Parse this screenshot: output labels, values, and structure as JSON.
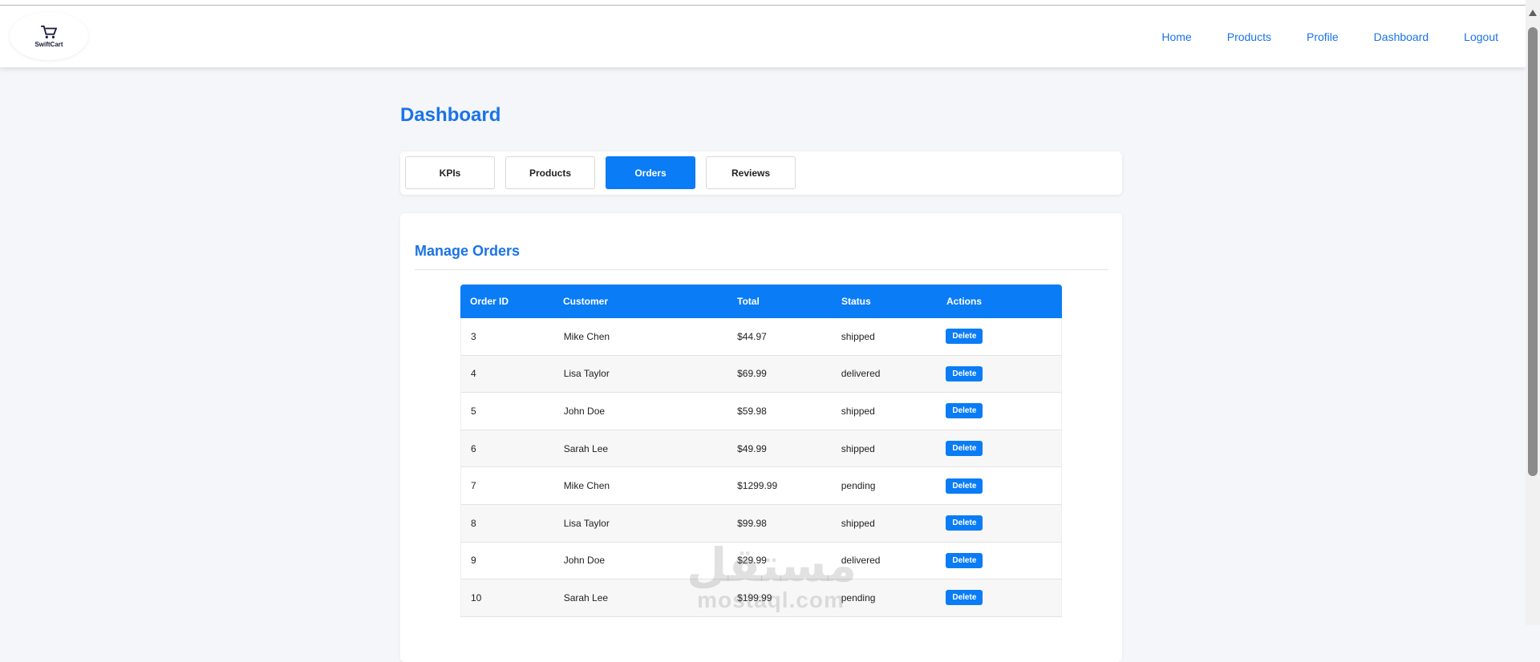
{
  "brand": {
    "name": "SwiftCart"
  },
  "nav": {
    "links": [
      "Home",
      "Products",
      "Profile",
      "Dashboard",
      "Logout"
    ]
  },
  "page": {
    "title": "Dashboard"
  },
  "tabs": [
    {
      "label": "KPIs",
      "active": false
    },
    {
      "label": "Products",
      "active": false
    },
    {
      "label": "Orders",
      "active": true
    },
    {
      "label": "Reviews",
      "active": false
    }
  ],
  "orders": {
    "title": "Manage Orders",
    "columns": [
      "Order ID",
      "Customer",
      "Total",
      "Status",
      "Actions"
    ],
    "delete_label": "Delete",
    "rows": [
      {
        "id": "3",
        "customer": "Mike Chen",
        "total": "$44.97",
        "status": "shipped"
      },
      {
        "id": "4",
        "customer": "Lisa Taylor",
        "total": "$69.99",
        "status": "delivered"
      },
      {
        "id": "5",
        "customer": "John Doe",
        "total": "$59.98",
        "status": "shipped"
      },
      {
        "id": "6",
        "customer": "Sarah Lee",
        "total": "$49.99",
        "status": "shipped"
      },
      {
        "id": "7",
        "customer": "Mike Chen",
        "total": "$1299.99",
        "status": "pending"
      },
      {
        "id": "8",
        "customer": "Lisa Taylor",
        "total": "$99.98",
        "status": "shipped"
      },
      {
        "id": "9",
        "customer": "John Doe",
        "total": "$29.99",
        "status": "delivered"
      },
      {
        "id": "10",
        "customer": "Sarah Lee",
        "total": "$199.99",
        "status": "pending"
      }
    ]
  },
  "watermark": {
    "arabic": "مستقل",
    "latin": "mostaql.com"
  },
  "colors": {
    "accent": "#0a7cf5",
    "link": "#1a73e8",
    "background": "#f4f6f9"
  }
}
